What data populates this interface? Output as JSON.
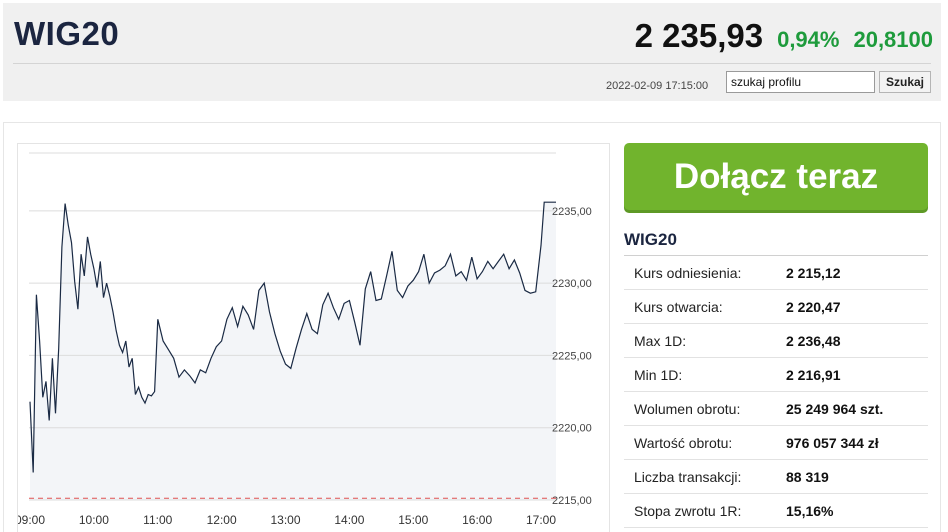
{
  "header": {
    "ticker": "WIG20",
    "price": "2 235,93",
    "change_pct": "0,94%",
    "change_abs": "20,8100",
    "timestamp": "2022-02-09 17:15:00",
    "search_value": "szukaj profilu",
    "search_button": "Szukaj"
  },
  "cta": {
    "label": "Dołącz teraz"
  },
  "stats": {
    "title": "WIG20",
    "rows": [
      {
        "label": "Kurs odniesienia:",
        "value": "2 215,12"
      },
      {
        "label": "Kurs otwarcia:",
        "value": "2 220,47"
      },
      {
        "label": "Max 1D:",
        "value": "2 236,48"
      },
      {
        "label": "Min 1D:",
        "value": "2 216,91"
      },
      {
        "label": "Wolumen obrotu:",
        "value": "25 249 964 szt."
      },
      {
        "label": "Wartość obrotu:",
        "value": "976 057 344 zł"
      },
      {
        "label": "Liczba transakcji:",
        "value": "88 319"
      },
      {
        "label": "Stopa zwrotu 1R:",
        "value": "15,16%"
      }
    ]
  },
  "colors": {
    "line": "#1a2a44",
    "area": "#f3f5f8",
    "grid": "#dcdcdc",
    "reference": "#e05050",
    "up": "#1e9b3c",
    "cta": "#71b42d"
  },
  "chart_data": {
    "type": "area",
    "ylim": [
      2215,
      2239
    ],
    "y_ticks": [
      2215,
      2220,
      2225,
      2230,
      2235
    ],
    "y_tick_labels": [
      "2215,00",
      "2220,00",
      "2225,00",
      "2230,00",
      "2235,00"
    ],
    "x_ticks": [
      "09:00",
      "10:00",
      "11:00",
      "12:00",
      "13:00",
      "14:00",
      "15:00",
      "16:00",
      "17:00"
    ],
    "reference_line": 2215.12,
    "grid": true,
    "series": [
      {
        "x": [
          "09:00",
          "09:03",
          "09:06",
          "09:09",
          "09:12",
          "09:15",
          "09:18",
          "09:21",
          "09:24",
          "09:27",
          "09:30",
          "09:33",
          "09:36",
          "09:39",
          "09:42",
          "09:45",
          "09:48",
          "09:51",
          "09:54",
          "09:57",
          "10:00",
          "10:03",
          "10:06",
          "10:09",
          "10:12",
          "10:15",
          "10:18",
          "10:21",
          "10:24",
          "10:27",
          "10:30",
          "10:33",
          "10:36",
          "10:39",
          "10:42",
          "10:45",
          "10:48",
          "10:51",
          "10:54",
          "10:57",
          "11:00",
          "11:05",
          "11:10",
          "11:15",
          "11:20",
          "11:25",
          "11:30",
          "11:35",
          "11:40",
          "11:45",
          "11:50",
          "11:55",
          "12:00",
          "12:05",
          "12:10",
          "12:15",
          "12:20",
          "12:25",
          "12:30",
          "12:35",
          "12:40",
          "12:45",
          "12:50",
          "12:55",
          "13:00",
          "13:05",
          "13:10",
          "13:15",
          "13:20",
          "13:25",
          "13:30",
          "13:35",
          "13:40",
          "13:45",
          "13:50",
          "13:55",
          "14:00",
          "14:05",
          "14:10",
          "14:15",
          "14:20",
          "14:25",
          "14:30",
          "14:35",
          "14:40",
          "14:45",
          "14:50",
          "14:55",
          "15:00",
          "15:05",
          "15:10",
          "15:15",
          "15:20",
          "15:25",
          "15:30",
          "15:35",
          "15:40",
          "15:45",
          "15:50",
          "15:55",
          "16:00",
          "16:05",
          "16:10",
          "16:15",
          "16:20",
          "16:25",
          "16:30",
          "16:35",
          "16:40",
          "16:45",
          "16:50",
          "16:55",
          "17:00",
          "17:03",
          "17:06"
        ],
        "values": [
          2221.8,
          2216.9,
          2229.2,
          2226.0,
          2222.1,
          2223.2,
          2220.5,
          2224.8,
          2221.0,
          2225.5,
          2232.5,
          2235.5,
          2234.0,
          2232.8,
          2230.1,
          2228.2,
          2232.0,
          2230.5,
          2233.2,
          2232.0,
          2231.0,
          2229.7,
          2231.5,
          2229.0,
          2230.0,
          2229.1,
          2228.0,
          2226.7,
          2225.7,
          2225.2,
          2226.0,
          2224.2,
          2224.8,
          2222.3,
          2222.8,
          2222.1,
          2221.7,
          2222.3,
          2222.2,
          2222.5,
          2227.5,
          2226.0,
          2225.4,
          2224.8,
          2223.5,
          2224.0,
          2223.6,
          2223.1,
          2224.0,
          2223.8,
          2224.8,
          2225.6,
          2226.0,
          2227.5,
          2228.3,
          2227.0,
          2228.4,
          2227.8,
          2226.8,
          2229.5,
          2230.0,
          2228.0,
          2226.5,
          2225.3,
          2224.4,
          2224.1,
          2225.5,
          2226.8,
          2227.9,
          2226.8,
          2226.5,
          2228.5,
          2229.3,
          2228.3,
          2227.5,
          2228.6,
          2228.8,
          2227.3,
          2225.7,
          2229.6,
          2230.8,
          2228.8,
          2228.9,
          2230.5,
          2232.2,
          2229.5,
          2229.0,
          2229.8,
          2230.2,
          2230.8,
          2232.0,
          2230.0,
          2230.7,
          2230.9,
          2231.2,
          2232.0,
          2230.5,
          2230.8,
          2230.2,
          2231.8,
          2230.3,
          2230.8,
          2231.5,
          2231.0,
          2231.5,
          2232.0,
          2231.0,
          2231.6,
          2230.7,
          2229.5,
          2229.3,
          2229.4,
          2232.6,
          2235.6,
          2235.6
        ]
      }
    ]
  }
}
